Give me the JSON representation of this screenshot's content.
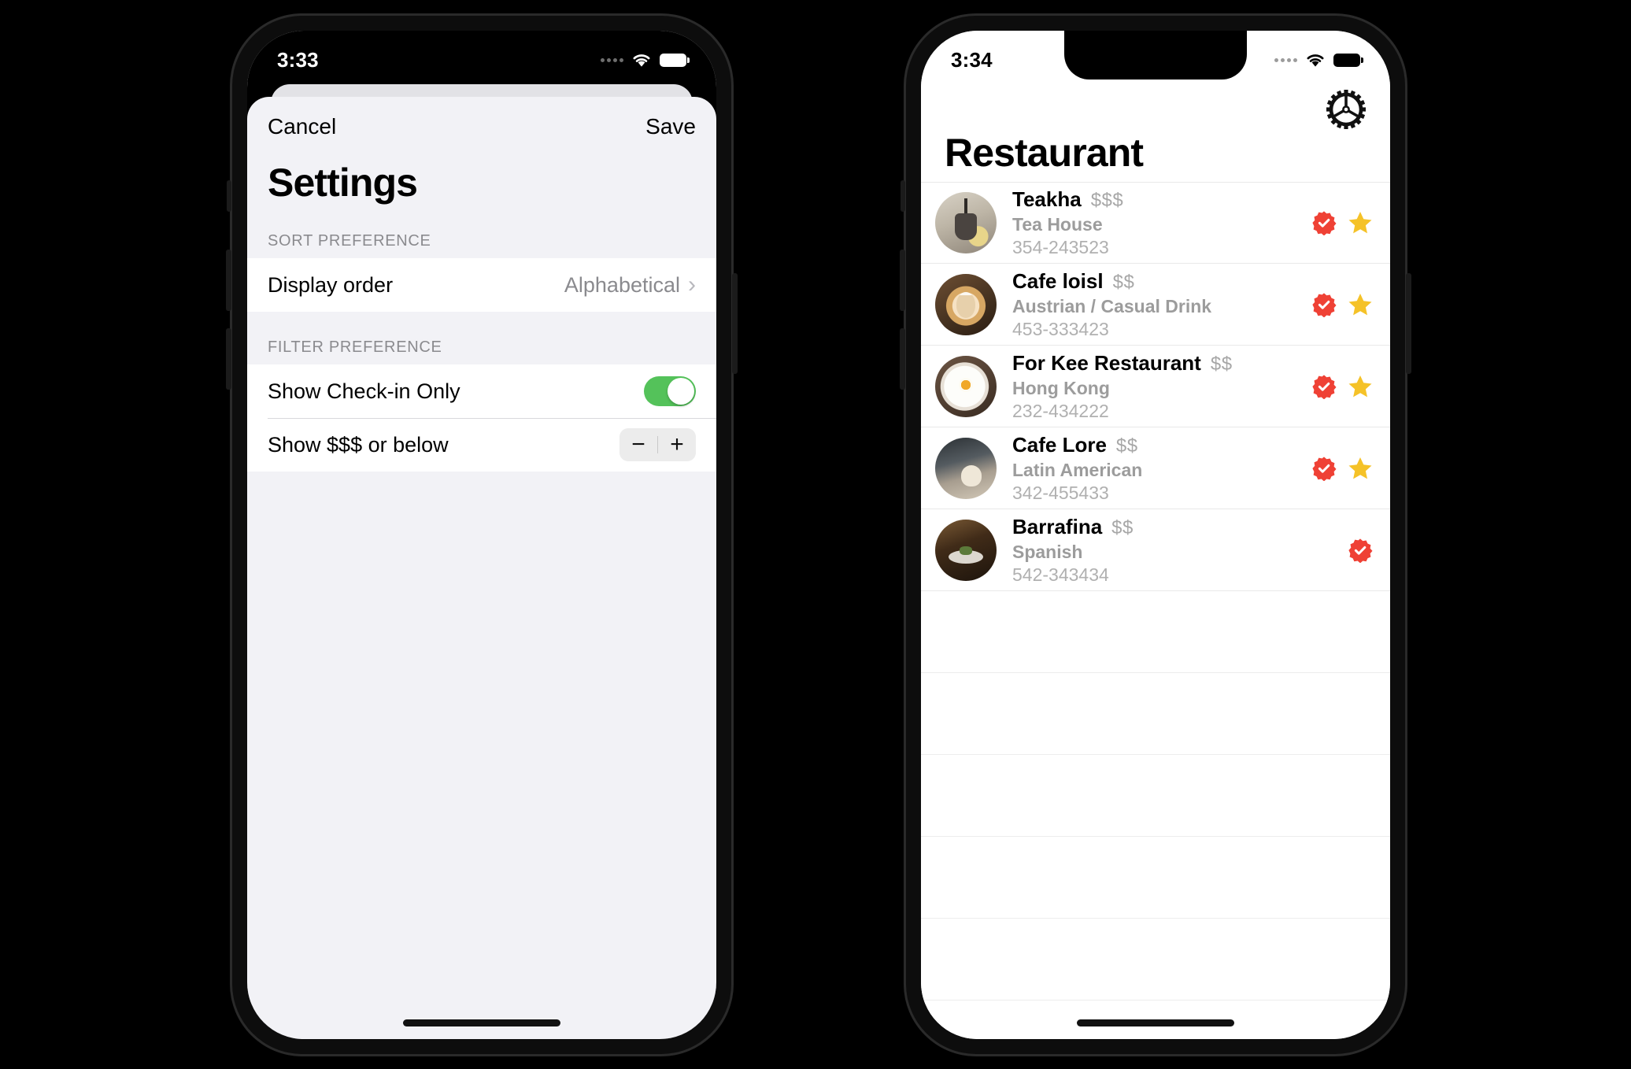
{
  "left_phone": {
    "status": {
      "time": "3:33",
      "wifi_icon": "wifi-icon",
      "battery_icon": "battery-icon"
    },
    "sheet": {
      "cancel_label": "Cancel",
      "save_label": "Save",
      "title": "Settings",
      "sections": [
        {
          "header": "SORT PREFERENCE",
          "rows": [
            {
              "label": "Display order",
              "value": "Alphabetical",
              "accessory": "chevron-right-icon",
              "type": "disclosure"
            }
          ]
        },
        {
          "header": "FILTER PREFERENCE",
          "rows": [
            {
              "label": "Show Check-in Only",
              "type": "toggle",
              "toggle_on": true
            },
            {
              "label": "Show $$$ or below",
              "type": "stepper",
              "minus_label": "−",
              "plus_label": "+"
            }
          ]
        }
      ]
    }
  },
  "right_phone": {
    "status": {
      "time": "3:34",
      "wifi_icon": "wifi-icon",
      "battery_icon": "battery-icon"
    },
    "settings_icon": "gear-icon",
    "title": "Restaurant",
    "restaurants": [
      {
        "name": "Teakha",
        "price": "$$$",
        "type": "Tea House",
        "phone": "354-243523",
        "checked": true,
        "starred": true,
        "thumb": "teakha-thumbnail"
      },
      {
        "name": "Cafe loisl",
        "price": "$$",
        "type": "Austrian / Casual Drink",
        "phone": "453-333423",
        "checked": true,
        "starred": true,
        "thumb": "cafe-loisl-thumbnail"
      },
      {
        "name": "For Kee Restaurant",
        "price": "$$",
        "type": "Hong Kong",
        "phone": "232-434222",
        "checked": true,
        "starred": true,
        "thumb": "for-kee-thumbnail"
      },
      {
        "name": "Cafe Lore",
        "price": "$$",
        "type": "Latin American",
        "phone": "342-455433",
        "checked": true,
        "starred": true,
        "thumb": "cafe-lore-thumbnail"
      },
      {
        "name": "Barrafina",
        "price": "$$",
        "type": "Spanish",
        "phone": "542-343434",
        "checked": true,
        "starred": false,
        "thumb": "barrafina-thumbnail"
      }
    ],
    "empty_row_count": 5
  },
  "colors": {
    "toggle_on": "#54c25a",
    "check_badge": "#ef4135",
    "star": "#f5c228",
    "sheet_bg": "#f2f2f6",
    "cell_bg": "#ffffff",
    "secondary_text": "#8a8a8e",
    "frame": "#0d0d0d"
  }
}
